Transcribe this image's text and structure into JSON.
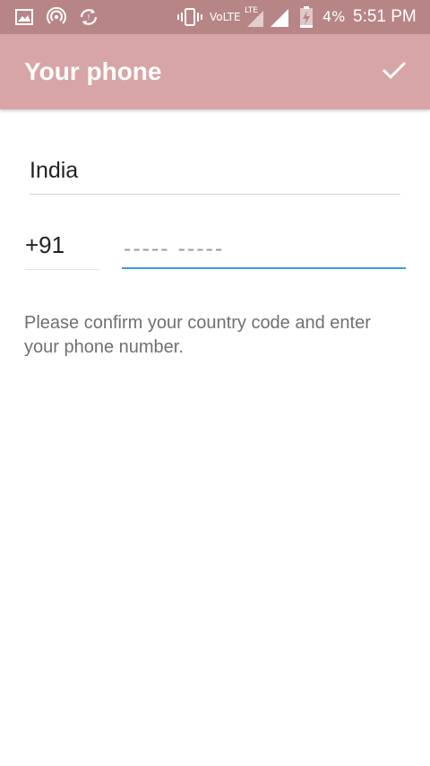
{
  "status_bar": {
    "icons_left": [
      "gallery-icon",
      "hotspot-icon",
      "sync-icon"
    ],
    "icons_right": [
      "vibrate-icon",
      "signal-icon",
      "battery-icon"
    ],
    "volte": "VoLTE",
    "lte": "LTE",
    "battery": "4%",
    "time": "5:51 PM"
  },
  "toolbar": {
    "title": "Your phone",
    "confirm_icon": "check-icon"
  },
  "form": {
    "country": "India",
    "country_code": "+91",
    "phone_placeholder": "----- -----",
    "phone_value": ""
  },
  "hint": "Please confirm your country code and enter your phone number.",
  "colors": {
    "status_bar": "#b88587",
    "toolbar": "#d7a5a5",
    "accent": "#3c9ed8"
  }
}
